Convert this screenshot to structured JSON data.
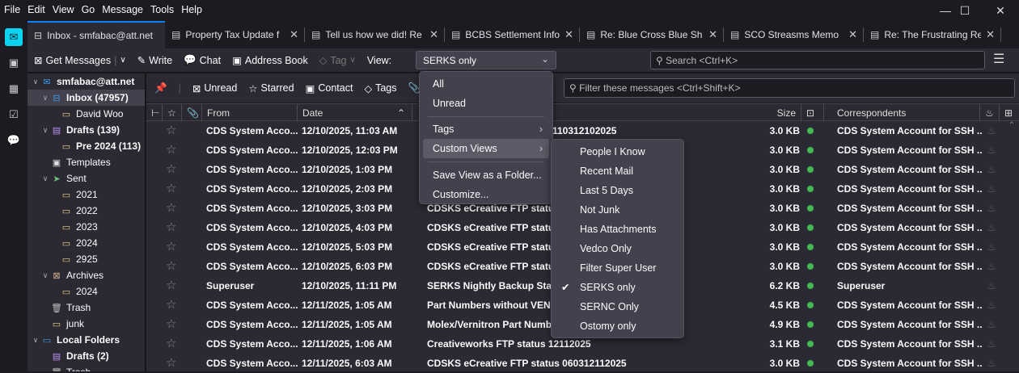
{
  "menubar": [
    "File",
    "Edit",
    "View",
    "Go",
    "Message",
    "Tools",
    "Help"
  ],
  "tabs": [
    {
      "label": "Inbox - smfabac@att.net",
      "active": true
    },
    {
      "label": "Property Tax Update f"
    },
    {
      "label": "Tell us how we did! Re"
    },
    {
      "label": "BCBS Settlement Info"
    },
    {
      "label": "Re: Blue Cross Blue Sh"
    },
    {
      "label": "SCO Streasms Memo"
    },
    {
      "label": "Re: The Frustrating Re"
    }
  ],
  "toolbar": {
    "get_messages": "Get Messages",
    "write": "Write",
    "chat": "Chat",
    "address_book": "Address Book",
    "tag": "Tag",
    "view_label": "View:",
    "view_value": "SERKS only",
    "search_placeholder": "Search <Ctrl+K>"
  },
  "folders": [
    {
      "name": "smfabac@att.net",
      "level": 0,
      "twisty": true,
      "icon": "✉",
      "color": "#3d9be9",
      "bold": true
    },
    {
      "name": "Inbox (47957)",
      "level": 1,
      "twisty": true,
      "icon": "⊟",
      "color": "#3d9be9",
      "bold": true,
      "selected": true
    },
    {
      "name": "David Woo",
      "level": 2,
      "icon": "▭",
      "color": "#e8d28a"
    },
    {
      "name": "Drafts (139)",
      "level": 1,
      "twisty": true,
      "icon": "▤",
      "color": "#c08ef0",
      "bold": true
    },
    {
      "name": "Pre 2024 (113)",
      "level": 2,
      "icon": "▭",
      "color": "#e8d28a",
      "bold": true
    },
    {
      "name": "Templates",
      "level": 1,
      "icon": "▣",
      "color": "#ddd"
    },
    {
      "name": "Sent",
      "level": 1,
      "twisty": true,
      "icon": "➤",
      "color": "#6ec37a"
    },
    {
      "name": "2021",
      "level": 2,
      "icon": "▭",
      "color": "#e8d28a"
    },
    {
      "name": "2022",
      "level": 2,
      "icon": "▭",
      "color": "#e8d28a"
    },
    {
      "name": "2023",
      "level": 2,
      "icon": "▭",
      "color": "#e8d28a"
    },
    {
      "name": "2024",
      "level": 2,
      "icon": "▭",
      "color": "#e8d28a"
    },
    {
      "name": "2925",
      "level": 2,
      "icon": "▭",
      "color": "#e8d28a"
    },
    {
      "name": "Archives",
      "level": 1,
      "twisty": true,
      "icon": "⊠",
      "color": "#d2b48c"
    },
    {
      "name": "2024",
      "level": 2,
      "icon": "▭",
      "color": "#e8d28a"
    },
    {
      "name": "Trash",
      "level": 1,
      "icon": "🗑",
      "color": "#bbb"
    },
    {
      "name": "junk",
      "level": 1,
      "icon": "▭",
      "color": "#e8d28a"
    },
    {
      "name": "Local Folders",
      "level": 0,
      "twisty": true,
      "icon": "▭",
      "color": "#3d9be9",
      "bold": true
    },
    {
      "name": "Drafts (2)",
      "level": 1,
      "icon": "▤",
      "color": "#c08ef0",
      "bold": true
    },
    {
      "name": "Trash",
      "level": 1,
      "icon": "🗑",
      "color": "#bbb"
    }
  ],
  "filterbar": {
    "unread": "Unread",
    "starred": "Starred",
    "contact": "Contact",
    "tags": "Tags",
    "filter_placeholder": "Filter these messages <Ctrl+Shift+K>"
  },
  "columns": {
    "from": "From",
    "date": "Date",
    "size": "Size",
    "correspondents": "Correspondents"
  },
  "messages": [
    {
      "from": "CDS System Acco...",
      "date": "12/10/2025, 11:03 AM",
      "subject": "110312102025",
      "size": "3.0 KB",
      "corr": "CDS System Account for SSH ..."
    },
    {
      "from": "CDS System Acco...",
      "date": "12/10/2025, 12:03 PM",
      "subject": "",
      "size": "3.0 KB",
      "corr": "CDS System Account for SSH ..."
    },
    {
      "from": "CDS System Acco...",
      "date": "12/10/2025, 1:03 PM",
      "subject": "",
      "size": "3.0 KB",
      "corr": "CDS System Account for SSH ..."
    },
    {
      "from": "CDS System Acco...",
      "date": "12/10/2025, 2:03 PM",
      "subject": "",
      "size": "3.0 KB",
      "corr": "CDS System Account for SSH ..."
    },
    {
      "from": "CDS System Acco...",
      "date": "12/10/2025, 3:03 PM",
      "subject": "CDSKS eCreative FTP status",
      "size": "3.0 KB",
      "corr": "CDS System Account for SSH ..."
    },
    {
      "from": "CDS System Acco...",
      "date": "12/10/2025, 4:03 PM",
      "subject": "CDSKS eCreative FTP status",
      "size": "3.0 KB",
      "corr": "CDS System Account for SSH ..."
    },
    {
      "from": "CDS System Acco...",
      "date": "12/10/2025, 5:03 PM",
      "subject": "CDSKS eCreative FTP status",
      "size": "3.0 KB",
      "corr": "CDS System Account for SSH ..."
    },
    {
      "from": "CDS System Acco...",
      "date": "12/10/2025, 6:03 PM",
      "subject": "CDSKS eCreative FTP status",
      "size": "3.0 KB",
      "corr": "CDS System Account for SSH ..."
    },
    {
      "from": "Superuser",
      "date": "12/10/2025, 11:11 PM",
      "subject": "SERKS Nightly Backup Statu",
      "size": "6.2 KB",
      "corr": "Superuser"
    },
    {
      "from": "CDS System Acco...",
      "date": "12/11/2025, 1:05 AM",
      "subject": "Part Numbers without VENI",
      "size": "4.5 KB",
      "corr": "CDS System Account for SSH ..."
    },
    {
      "from": "CDS System Acco...",
      "date": "12/11/2025, 1:05 AM",
      "subject": "Molex/Vernitron Part Numb",
      "size": "4.9 KB",
      "corr": "CDS System Account for SSH ..."
    },
    {
      "from": "CDS System Acco...",
      "date": "12/11/2025, 1:06 AM",
      "subject": "Creativeworks FTP status 12112025",
      "size": "3.1 KB",
      "corr": "CDS System Account for SSH ..."
    },
    {
      "from": "CDS System Acco...",
      "date": "12/11/2025, 6:03 AM",
      "subject": "CDSKS eCreative FTP status 060312112025",
      "size": "3.0 KB",
      "corr": "CDS System Account for SSH ..."
    }
  ],
  "view_menu": {
    "all": "All",
    "unread": "Unread",
    "tags": "Tags",
    "custom_views": "Custom Views",
    "save_view": "Save View as a Folder...",
    "customize": "Customize..."
  },
  "custom_views": [
    "People I Know",
    "Recent Mail",
    "Last 5 Days",
    "Not Junk",
    "Has Attachments",
    "Vedco Only",
    "Filter Super User",
    "SERKS only",
    "SERNC Only",
    "Ostomy only"
  ],
  "checked_view": "SERKS only",
  "colors": {
    "accent": "#0a84ff",
    "read_dot": "#3fb950"
  }
}
